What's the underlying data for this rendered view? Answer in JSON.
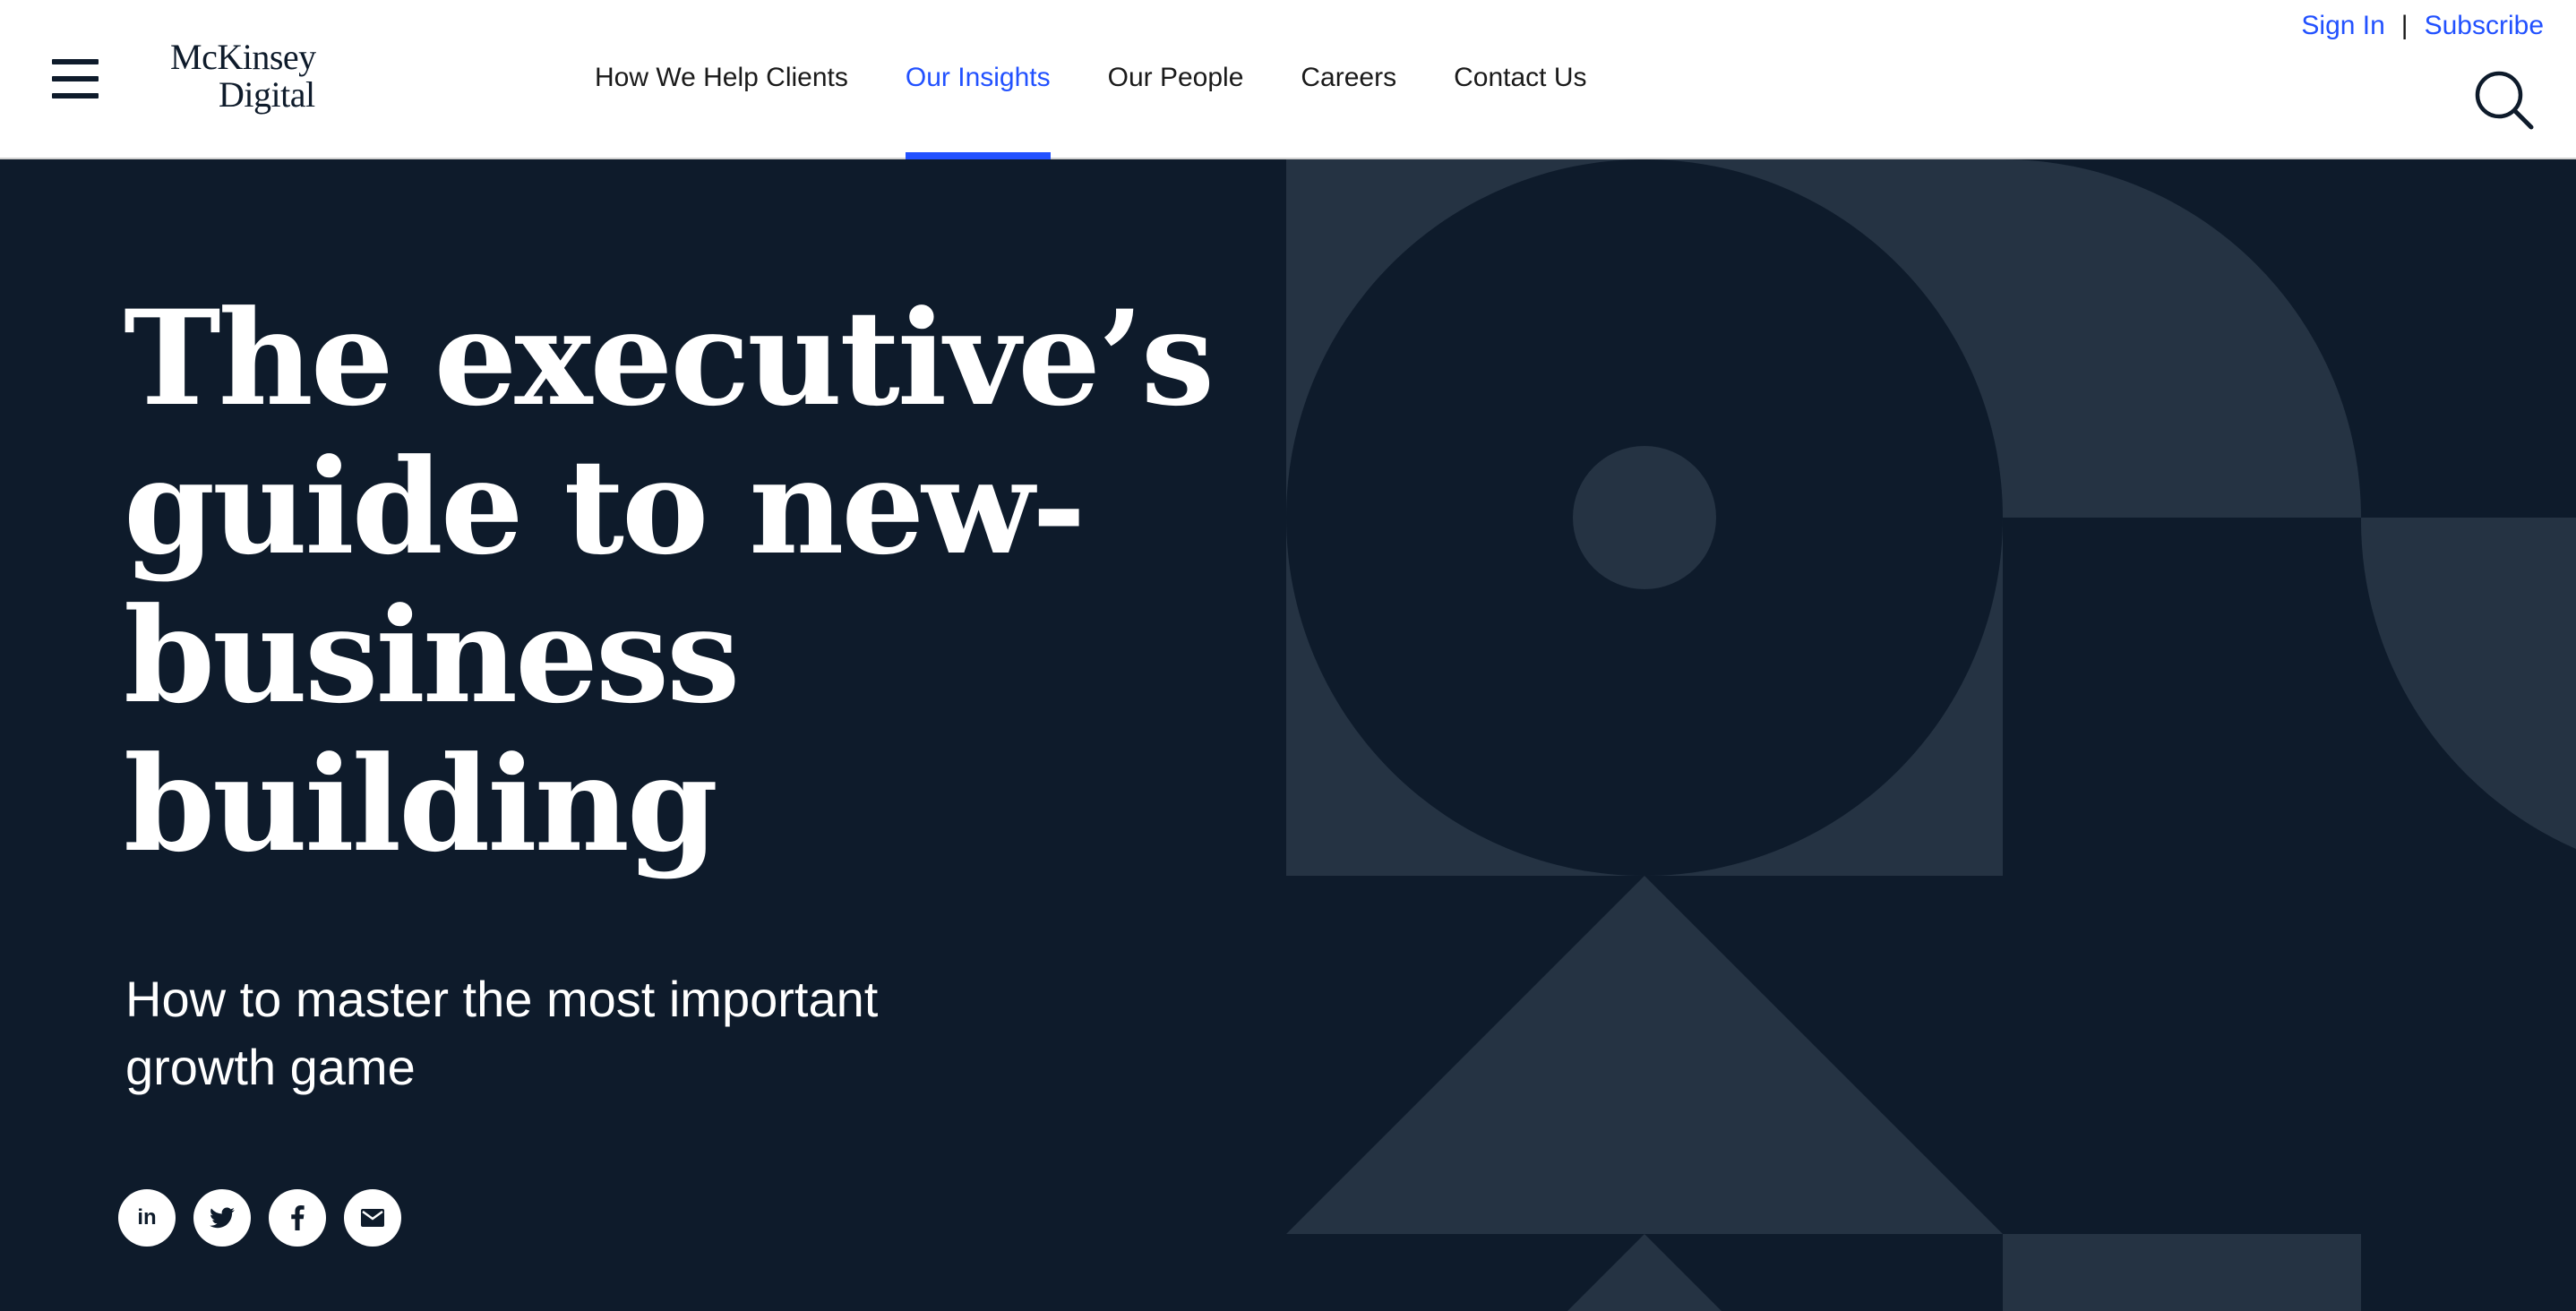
{
  "header": {
    "logo": {
      "line1": "McKinsey",
      "line2": "Digital"
    },
    "nav": [
      {
        "label": "How We Help Clients",
        "active": false
      },
      {
        "label": "Our Insights",
        "active": true
      },
      {
        "label": "Our People",
        "active": false
      },
      {
        "label": "Careers",
        "active": false
      },
      {
        "label": "Contact Us",
        "active": false
      }
    ],
    "sign_in": "Sign In",
    "separator": "|",
    "subscribe": "Subscribe",
    "menu_icon": "hamburger-menu-icon",
    "search_icon": "search-icon"
  },
  "hero": {
    "title": "The executive’s guide to new-business building",
    "subtitle": "How to master the most important growth game",
    "share": [
      {
        "icon": "linkedin-icon",
        "text": "in"
      },
      {
        "icon": "twitter-icon"
      },
      {
        "icon": "facebook-icon"
      },
      {
        "icon": "email-icon"
      }
    ]
  },
  "colors": {
    "background": "#0e1b2b",
    "shape": "#253343",
    "accent": "#2251ff",
    "header_bg": "#ffffff"
  }
}
